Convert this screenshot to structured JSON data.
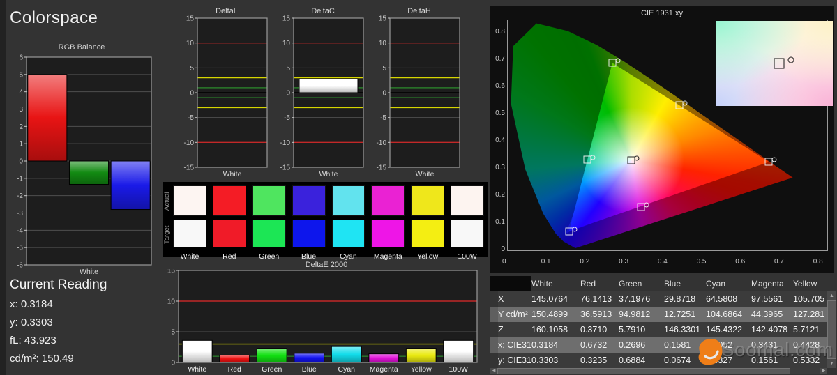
{
  "app": {
    "title": "Colorspace"
  },
  "current_reading": {
    "title": "Current Reading",
    "items": [
      "x: 0.3184",
      "y: 0.3303",
      "fL: 43.923",
      "cd/m²: 150.49"
    ]
  },
  "colors": {
    "ref_red": "#c22828",
    "ref_yellow": "#d6d600",
    "ref_green": "#2a7a2a",
    "grid": "#4f4f4f",
    "axis": "#9a9a9a",
    "plot_bg": "#1d1d1d"
  },
  "chart_data": [
    {
      "id": "rgb",
      "type": "bar",
      "title": "RGB Balance",
      "xlabel": "White",
      "categories": [
        "Red",
        "Green",
        "Blue"
      ],
      "values": [
        5.0,
        -1.35,
        -2.8
      ],
      "colors": [
        "#e81414",
        "#128a12",
        "#1a1ae8"
      ],
      "ylim": [
        -6,
        6
      ],
      "yticks": [
        6,
        5,
        4,
        3,
        2,
        1,
        0,
        -1,
        -2,
        -3,
        -4,
        -5,
        -6
      ],
      "grid_ticks": [
        6,
        5,
        4,
        3,
        2,
        1,
        0,
        -1,
        -2,
        -3,
        -4,
        -5,
        -6
      ],
      "ref_lines": []
    },
    {
      "id": "deltaL",
      "type": "bar",
      "title": "DeltaL",
      "xlabel": "White",
      "categories": [
        "White"
      ],
      "values": [
        0
      ],
      "colors": [
        "#ffffff"
      ],
      "ylim": [
        -15,
        15
      ],
      "yticks": [
        15,
        10,
        5,
        0,
        -5,
        -10,
        -15
      ],
      "grid_ticks": [
        5,
        -5
      ],
      "zero_line": "#000000",
      "ref_lines": [
        {
          "y": 10,
          "color": "#c22828"
        },
        {
          "y": -10,
          "color": "#c22828"
        },
        {
          "y": 3,
          "color": "#d6d600"
        },
        {
          "y": -3,
          "color": "#d6d600"
        },
        {
          "y": 1,
          "color": "#2a7a2a"
        },
        {
          "y": -1,
          "color": "#2a7a2a"
        }
      ]
    },
    {
      "id": "deltaC",
      "type": "bar",
      "title": "DeltaC",
      "xlabel": "White",
      "categories": [
        "White"
      ],
      "values": [
        2.8
      ],
      "colors": [
        "#ffffff"
      ],
      "ylim": [
        -15,
        15
      ],
      "yticks": [
        15,
        10,
        5,
        0,
        -5,
        -10,
        -15
      ],
      "grid_ticks": [
        5,
        -5
      ],
      "zero_line": "#000000",
      "ref_lines": [
        {
          "y": 10,
          "color": "#c22828"
        },
        {
          "y": -10,
          "color": "#c22828"
        },
        {
          "y": 3,
          "color": "#d6d600"
        },
        {
          "y": -3,
          "color": "#d6d600"
        },
        {
          "y": 1,
          "color": "#2a7a2a"
        },
        {
          "y": -1,
          "color": "#2a7a2a"
        }
      ]
    },
    {
      "id": "deltaH",
      "type": "bar",
      "title": "DeltaH",
      "xlabel": "White",
      "categories": [
        "White"
      ],
      "values": [
        0
      ],
      "colors": [
        "#ffffff"
      ],
      "ylim": [
        -15,
        15
      ],
      "yticks": [
        15,
        10,
        5,
        0,
        -5,
        -10,
        -15
      ],
      "grid_ticks": [
        5,
        -5
      ],
      "zero_line": "#000000",
      "ref_lines": [
        {
          "y": 10,
          "color": "#c22828"
        },
        {
          "y": -10,
          "color": "#c22828"
        },
        {
          "y": 3,
          "color": "#d6d600"
        },
        {
          "y": -3,
          "color": "#d6d600"
        },
        {
          "y": 1,
          "color": "#2a7a2a"
        },
        {
          "y": -1,
          "color": "#2a7a2a"
        }
      ]
    },
    {
      "id": "deltae2000",
      "type": "bar",
      "title": "DeltaE 2000",
      "categories": [
        "White",
        "Red",
        "Green",
        "Blue",
        "Cyan",
        "Magenta",
        "Yellow",
        "100W"
      ],
      "values": [
        3.6,
        1.2,
        2.3,
        1.5,
        2.6,
        1.4,
        2.3,
        3.6
      ],
      "colors": [
        "#ffffff",
        "#ee1111",
        "#12e112",
        "#1212ee",
        "#12dcea",
        "#e112d8",
        "#eaea10",
        "#ffffff"
      ],
      "ylim": [
        0,
        15
      ],
      "yticks": [
        15,
        10,
        5,
        0
      ],
      "grid_ticks": [
        5,
        10,
        15
      ],
      "ref_lines": [
        {
          "y": 10,
          "color": "#c22828"
        },
        {
          "y": 3,
          "color": "#d6d600"
        },
        {
          "y": 1,
          "color": "#2a7a2a"
        }
      ]
    },
    {
      "id": "cie",
      "type": "scatter",
      "title": "CIE 1931 xy",
      "xlim": [
        0,
        0.822
      ],
      "ylim": [
        0,
        0.846
      ],
      "xticks": [
        0,
        0.1,
        0.2,
        0.3,
        0.4,
        0.5,
        0.6,
        0.7,
        0.8
      ],
      "yticks": [
        0.8,
        0.7,
        0.6,
        0.5,
        0.4,
        0.3,
        0.2,
        0.1,
        0
      ],
      "points": [
        {
          "name": "White",
          "x": 0.3184,
          "y": 0.3303,
          "dark": true
        },
        {
          "name": "Red",
          "x": 0.6732,
          "y": 0.3235
        },
        {
          "name": "Green",
          "x": 0.2696,
          "y": 0.6884
        },
        {
          "name": "Blue",
          "x": 0.1581,
          "y": 0.0674
        },
        {
          "name": "Cyan",
          "x": 0.2052,
          "y": 0.3327
        },
        {
          "name": "Magenta",
          "x": 0.3431,
          "y": 0.1561
        },
        {
          "name": "Yellow",
          "x": 0.4428,
          "y": 0.5332
        }
      ],
      "gamut_measured": [
        [
          0.6732,
          0.3235
        ],
        [
          0.2696,
          0.6884
        ],
        [
          0.1581,
          0.0674
        ]
      ],
      "gamut_reference": [
        [
          0.64,
          0.33
        ],
        [
          0.3,
          0.6
        ],
        [
          0.15,
          0.06
        ]
      ]
    }
  ],
  "swatches": {
    "row_labels": [
      "Actual",
      "Target"
    ],
    "columns": [
      "White",
      "Red",
      "Green",
      "Blue",
      "Cyan",
      "Magenta",
      "Yellow",
      "100W"
    ],
    "actual_colors": [
      "#fdf5f2",
      "#f41c25",
      "#4fe55f",
      "#3a22dc",
      "#62e3ee",
      "#ea22d3",
      "#efe71b",
      "#fdf4f0"
    ],
    "target_colors": [
      "#f8f8f8",
      "#f01b28",
      "#1ce655",
      "#0d16ec",
      "#1fe4f3",
      "#ee15e7",
      "#f4ee12",
      "#f8f8f8"
    ]
  },
  "table": {
    "headers": [
      "",
      "White",
      "Red",
      "Green",
      "Blue",
      "Cyan",
      "Magenta",
      "Yellow"
    ],
    "rows": [
      {
        "label": "X",
        "values": [
          "145.0764",
          "76.1413",
          "37.1976",
          "29.8718",
          "64.5808",
          "97.5561",
          "105.705"
        ]
      },
      {
        "label": "Y cd/m²",
        "values": [
          "150.4899",
          "36.5913",
          "94.9812",
          "12.7251",
          "104.6864",
          "44.3965",
          "127.281"
        ]
      },
      {
        "label": "Z",
        "values": [
          "160.1058",
          "0.3710",
          "5.7910",
          "146.3301",
          "145.4322",
          "142.4078",
          "5.7121"
        ]
      },
      {
        "label": "x: CIE31",
        "values": [
          "0.3184",
          "0.6732",
          "0.2696",
          "0.1581",
          "0.2052",
          "0.3431",
          "0.4428"
        ]
      },
      {
        "label": "y: CIE31",
        "values": [
          "0.3303",
          "0.3235",
          "0.6884",
          "0.0674",
          "0.3327",
          "0.1561",
          "0.5332"
        ]
      }
    ]
  },
  "watermark": {
    "text": "Soomal.com"
  }
}
